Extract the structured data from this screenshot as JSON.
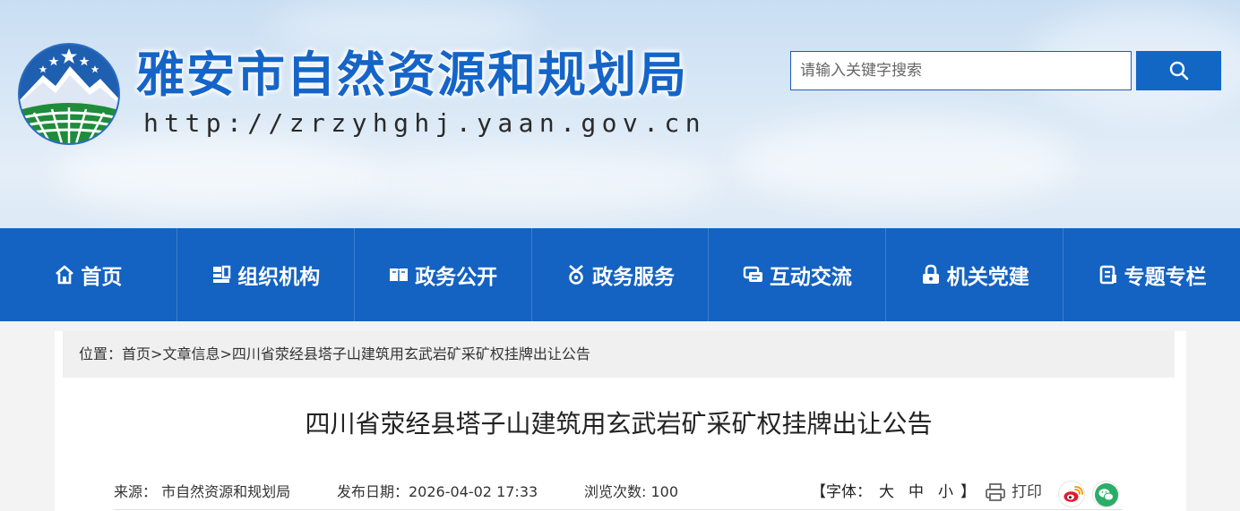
{
  "header": {
    "site_title": "雅安市自然资源和规划局",
    "site_url": "http://zrzyhghj.yaan.gov.cn",
    "logo_icon": "mountain-stars-emblem-icon",
    "search": {
      "placeholder": "请输入关键字搜索",
      "button_icon": "search-icon"
    }
  },
  "colors": {
    "primary": "#1462c1",
    "title_blue": "#1565c8",
    "nav_text": "#ffffff",
    "weibo": "#e6162d",
    "wechat": "#2aae67"
  },
  "nav": {
    "items": [
      {
        "label": "首页",
        "icon": "home-icon"
      },
      {
        "label": "组织机构",
        "icon": "org-chart-icon"
      },
      {
        "label": "政务公开",
        "icon": "open-book-icon"
      },
      {
        "label": "政务服务",
        "icon": "service-badge-icon"
      },
      {
        "label": "互动交流",
        "icon": "chat-bubble-icon"
      },
      {
        "label": "机关党建",
        "icon": "lock-party-icon"
      },
      {
        "label": "专题专栏",
        "icon": "document-icon"
      }
    ]
  },
  "breadcrumb": {
    "prefix": "位置：",
    "home": "首页",
    "sep1": ">",
    "section": "文章信息",
    "sep2": ">",
    "current": "四川省荥经县塔子山建筑用玄武岩矿采矿权挂牌出让公告"
  },
  "article": {
    "title": "四川省荥经县塔子山建筑用玄武岩矿采矿权挂牌出让公告",
    "source": "来源：  市自然资源和规划局",
    "publish_date": "发布日期：2026-04-02 17:33",
    "views": "浏览次数: 100"
  },
  "tools": {
    "font_size_prefix": "【字体：",
    "font_large": "大",
    "font_medium": "中",
    "font_small": "小",
    "font_size_suffix": "】",
    "print_label": "打印",
    "print_icon": "printer-icon",
    "share_weibo_icon": "weibo-icon",
    "share_wechat_icon": "wechat-icon"
  }
}
